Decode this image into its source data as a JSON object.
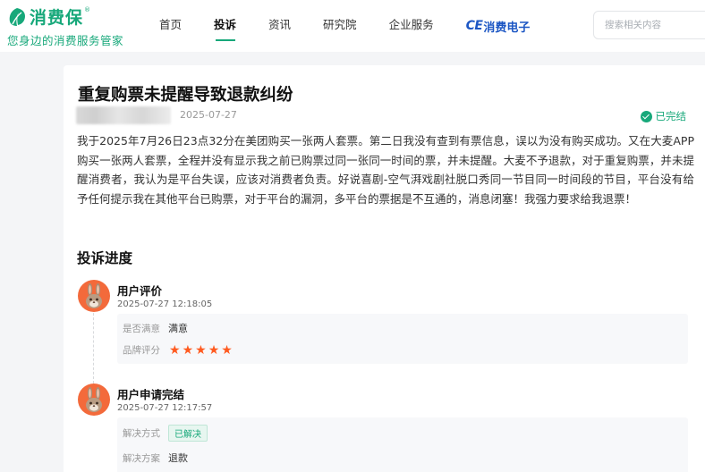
{
  "brand": {
    "name": "消费保",
    "registered_mark": "®",
    "slogan": "您身边的消费服务管家",
    "color": "#17a87a"
  },
  "nav": {
    "items": [
      "首页",
      "投诉",
      "资讯",
      "研究院",
      "企业服务"
    ],
    "active_index": 1,
    "brand_link": {
      "prefix": "CE",
      "label": "消费电子"
    }
  },
  "search": {
    "placeholder": "搜索相关内容"
  },
  "complaint": {
    "title": "重复购票未提醒导致退款纠纷",
    "date": "2025-07-27",
    "status": "已完结",
    "body": "我于2025年7月26日23点32分在美团购买一张两人套票。第二日我没有查到有票信息，误以为没有购买成功。又在大麦APP购买一张两人套票，全程并没有显示我之前已购票过同一张同一时间的票，并未提醒。大麦不予退款，对于重复购票，并未提醒消费者，我认为是平台失误，应该对消费者负责。好说喜剧-空气湃戏剧社脱口秀同一节目同一时间段的节目，平台没有给予任何提示我在其他平台已购票，对于平台的漏洞，多平台的票据是不互通的，消息闭塞！我强力要求给我退票！"
  },
  "progress": {
    "title": "投诉进度",
    "items": [
      {
        "name": "用户评价",
        "time": "2025-07-27 12:18:05",
        "satisfaction_label": "是否满意",
        "satisfaction_value": "满意",
        "rating_label": "品牌评分",
        "rating": 5
      },
      {
        "name": "用户申请完结",
        "time": "2025-07-27 12:17:57",
        "method_label": "解决方式",
        "method_value": "已解决",
        "plan_label": "解决方案",
        "plan_value": "退款"
      }
    ]
  },
  "colors": {
    "accent": "#17a87a",
    "star": "#ff5a1f",
    "avatar": "#f36a3b",
    "brand_link": "#1d57c4"
  }
}
